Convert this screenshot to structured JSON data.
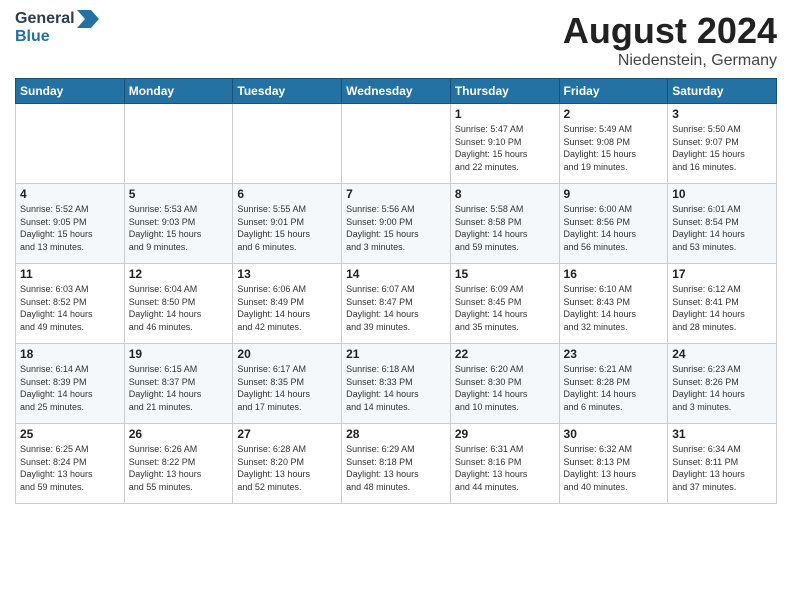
{
  "header": {
    "logo_line1": "General",
    "logo_line2": "Blue",
    "month_title": "August 2024",
    "location": "Niedenstein, Germany"
  },
  "weekdays": [
    "Sunday",
    "Monday",
    "Tuesday",
    "Wednesday",
    "Thursday",
    "Friday",
    "Saturday"
  ],
  "weeks": [
    [
      {
        "day": "",
        "info": ""
      },
      {
        "day": "",
        "info": ""
      },
      {
        "day": "",
        "info": ""
      },
      {
        "day": "",
        "info": ""
      },
      {
        "day": "1",
        "info": "Sunrise: 5:47 AM\nSunset: 9:10 PM\nDaylight: 15 hours\nand 22 minutes."
      },
      {
        "day": "2",
        "info": "Sunrise: 5:49 AM\nSunset: 9:08 PM\nDaylight: 15 hours\nand 19 minutes."
      },
      {
        "day": "3",
        "info": "Sunrise: 5:50 AM\nSunset: 9:07 PM\nDaylight: 15 hours\nand 16 minutes."
      }
    ],
    [
      {
        "day": "4",
        "info": "Sunrise: 5:52 AM\nSunset: 9:05 PM\nDaylight: 15 hours\nand 13 minutes."
      },
      {
        "day": "5",
        "info": "Sunrise: 5:53 AM\nSunset: 9:03 PM\nDaylight: 15 hours\nand 9 minutes."
      },
      {
        "day": "6",
        "info": "Sunrise: 5:55 AM\nSunset: 9:01 PM\nDaylight: 15 hours\nand 6 minutes."
      },
      {
        "day": "7",
        "info": "Sunrise: 5:56 AM\nSunset: 9:00 PM\nDaylight: 15 hours\nand 3 minutes."
      },
      {
        "day": "8",
        "info": "Sunrise: 5:58 AM\nSunset: 8:58 PM\nDaylight: 14 hours\nand 59 minutes."
      },
      {
        "day": "9",
        "info": "Sunrise: 6:00 AM\nSunset: 8:56 PM\nDaylight: 14 hours\nand 56 minutes."
      },
      {
        "day": "10",
        "info": "Sunrise: 6:01 AM\nSunset: 8:54 PM\nDaylight: 14 hours\nand 53 minutes."
      }
    ],
    [
      {
        "day": "11",
        "info": "Sunrise: 6:03 AM\nSunset: 8:52 PM\nDaylight: 14 hours\nand 49 minutes."
      },
      {
        "day": "12",
        "info": "Sunrise: 6:04 AM\nSunset: 8:50 PM\nDaylight: 14 hours\nand 46 minutes."
      },
      {
        "day": "13",
        "info": "Sunrise: 6:06 AM\nSunset: 8:49 PM\nDaylight: 14 hours\nand 42 minutes."
      },
      {
        "day": "14",
        "info": "Sunrise: 6:07 AM\nSunset: 8:47 PM\nDaylight: 14 hours\nand 39 minutes."
      },
      {
        "day": "15",
        "info": "Sunrise: 6:09 AM\nSunset: 8:45 PM\nDaylight: 14 hours\nand 35 minutes."
      },
      {
        "day": "16",
        "info": "Sunrise: 6:10 AM\nSunset: 8:43 PM\nDaylight: 14 hours\nand 32 minutes."
      },
      {
        "day": "17",
        "info": "Sunrise: 6:12 AM\nSunset: 8:41 PM\nDaylight: 14 hours\nand 28 minutes."
      }
    ],
    [
      {
        "day": "18",
        "info": "Sunrise: 6:14 AM\nSunset: 8:39 PM\nDaylight: 14 hours\nand 25 minutes."
      },
      {
        "day": "19",
        "info": "Sunrise: 6:15 AM\nSunset: 8:37 PM\nDaylight: 14 hours\nand 21 minutes."
      },
      {
        "day": "20",
        "info": "Sunrise: 6:17 AM\nSunset: 8:35 PM\nDaylight: 14 hours\nand 17 minutes."
      },
      {
        "day": "21",
        "info": "Sunrise: 6:18 AM\nSunset: 8:33 PM\nDaylight: 14 hours\nand 14 minutes."
      },
      {
        "day": "22",
        "info": "Sunrise: 6:20 AM\nSunset: 8:30 PM\nDaylight: 14 hours\nand 10 minutes."
      },
      {
        "day": "23",
        "info": "Sunrise: 6:21 AM\nSunset: 8:28 PM\nDaylight: 14 hours\nand 6 minutes."
      },
      {
        "day": "24",
        "info": "Sunrise: 6:23 AM\nSunset: 8:26 PM\nDaylight: 14 hours\nand 3 minutes."
      }
    ],
    [
      {
        "day": "25",
        "info": "Sunrise: 6:25 AM\nSunset: 8:24 PM\nDaylight: 13 hours\nand 59 minutes."
      },
      {
        "day": "26",
        "info": "Sunrise: 6:26 AM\nSunset: 8:22 PM\nDaylight: 13 hours\nand 55 minutes."
      },
      {
        "day": "27",
        "info": "Sunrise: 6:28 AM\nSunset: 8:20 PM\nDaylight: 13 hours\nand 52 minutes."
      },
      {
        "day": "28",
        "info": "Sunrise: 6:29 AM\nSunset: 8:18 PM\nDaylight: 13 hours\nand 48 minutes."
      },
      {
        "day": "29",
        "info": "Sunrise: 6:31 AM\nSunset: 8:16 PM\nDaylight: 13 hours\nand 44 minutes."
      },
      {
        "day": "30",
        "info": "Sunrise: 6:32 AM\nSunset: 8:13 PM\nDaylight: 13 hours\nand 40 minutes."
      },
      {
        "day": "31",
        "info": "Sunrise: 6:34 AM\nSunset: 8:11 PM\nDaylight: 13 hours\nand 37 minutes."
      }
    ]
  ]
}
